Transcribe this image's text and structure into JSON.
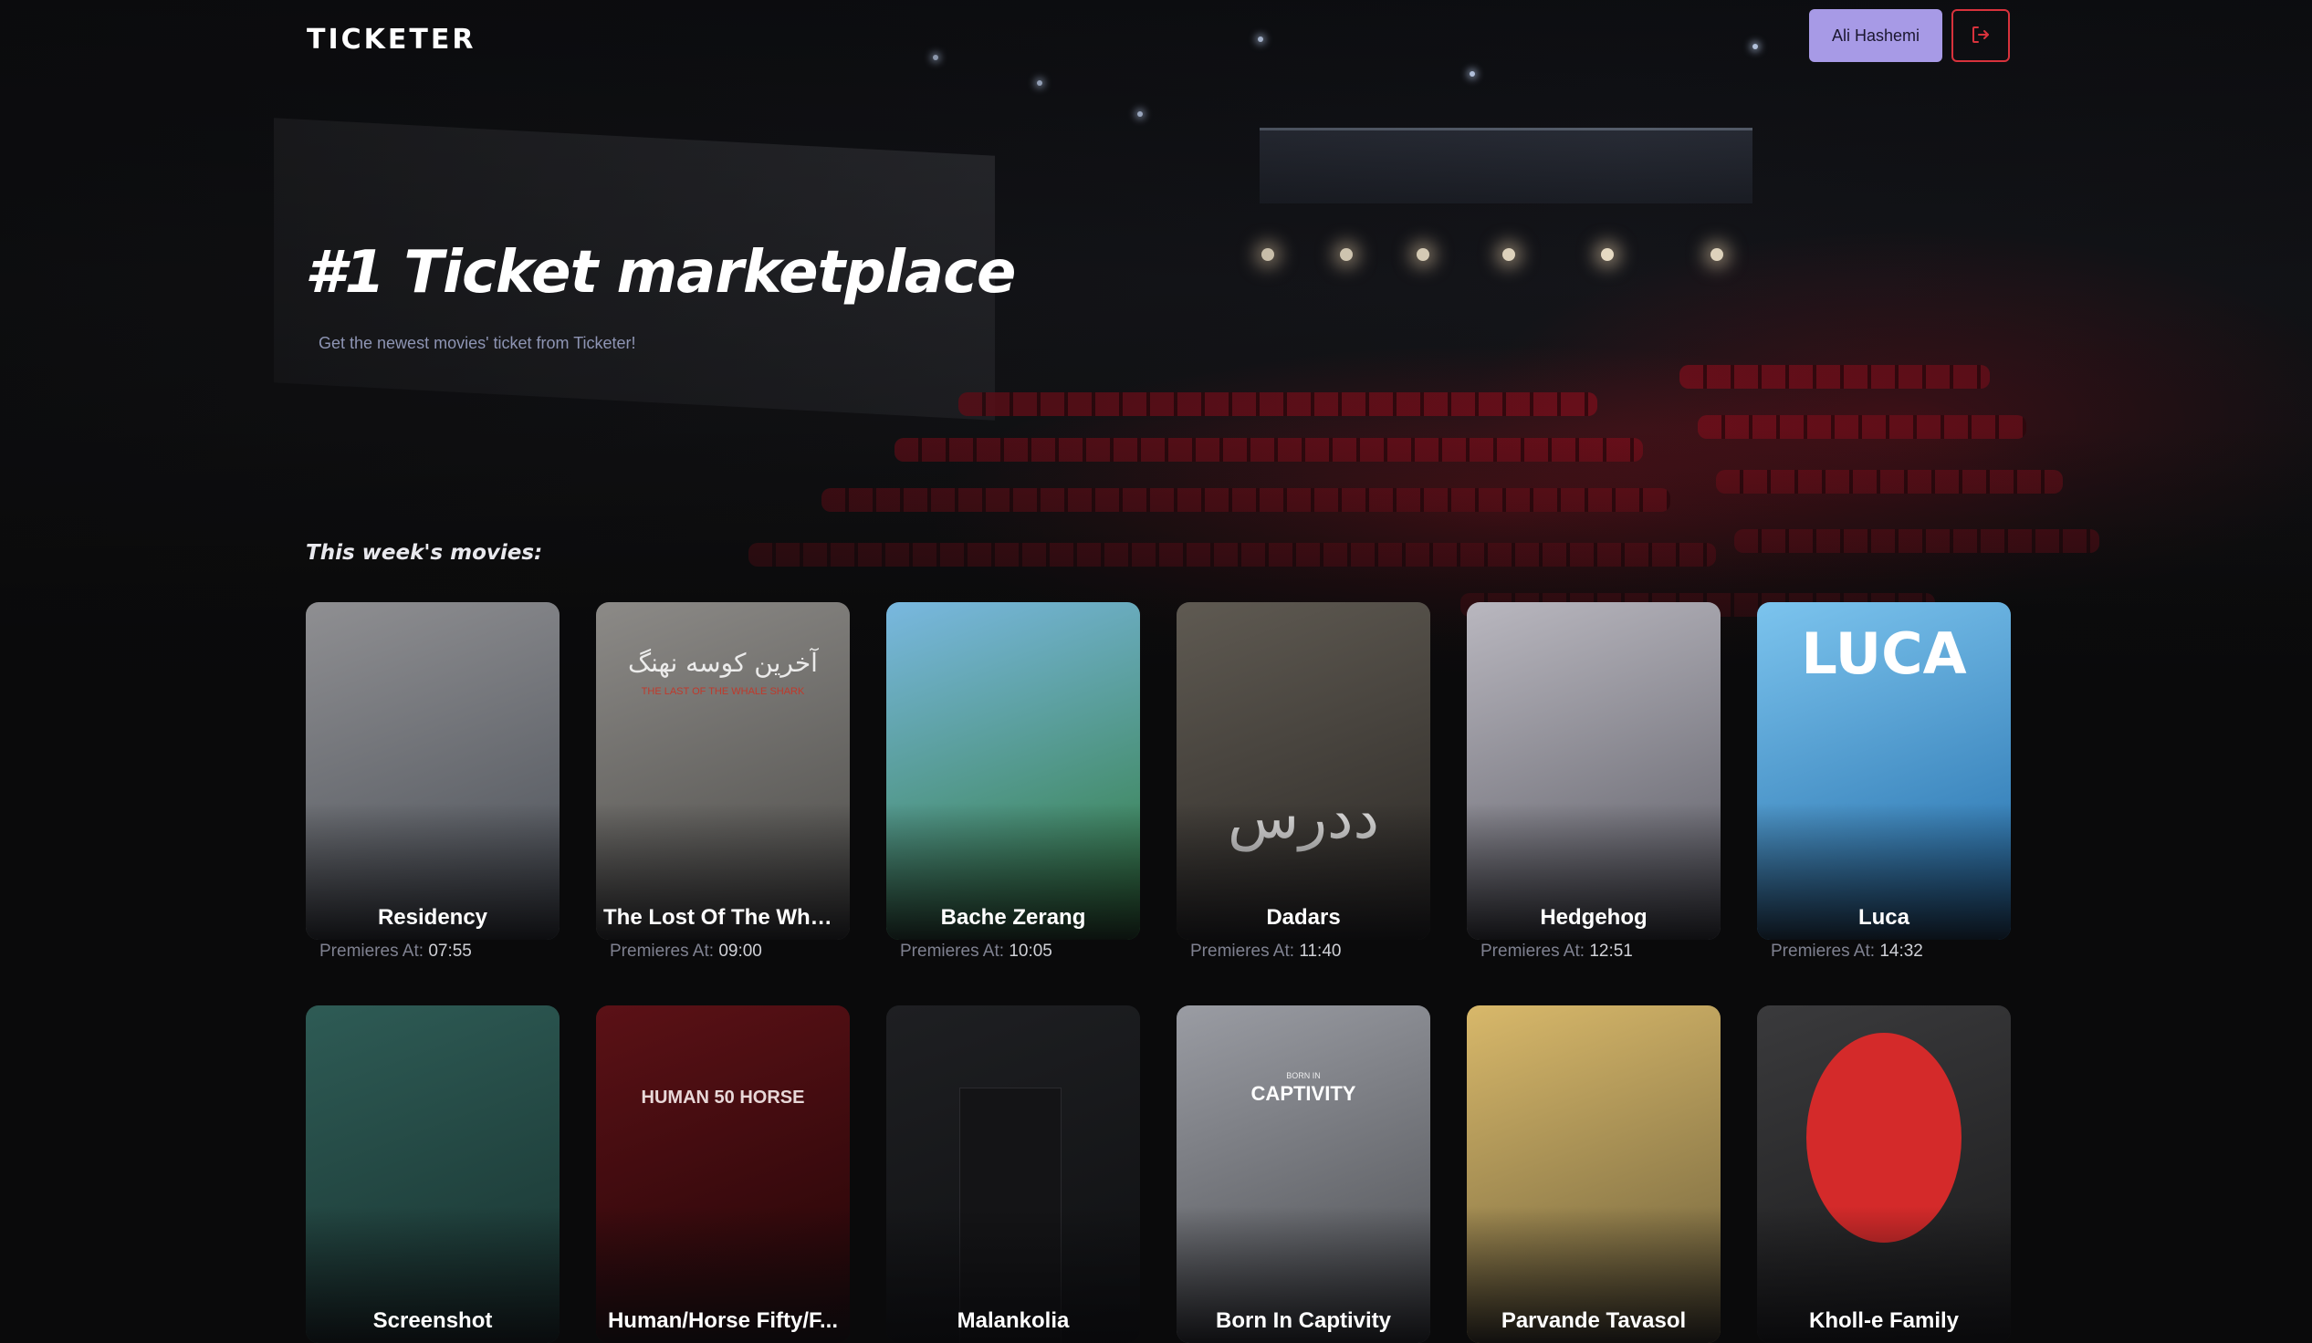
{
  "header": {
    "logo": "TICKETER",
    "user_name": "Ali Hashemi",
    "logout_icon": "logout-icon"
  },
  "hero": {
    "title": "#1 Ticket marketplace",
    "subtitle": "Get the newest movies' ticket from Ticketer!"
  },
  "section": {
    "title": "This week's movies:"
  },
  "premiere_label": "Premieres At:",
  "movies": [
    {
      "title": "Residency",
      "time": "07:55",
      "colors": [
        "#8f8f92",
        "#4a4f57"
      ]
    },
    {
      "title": "The Lost Of The Whal...",
      "time": "09:00",
      "colors": [
        "#8c8a87",
        "#4b4a47"
      ]
    },
    {
      "title": "Bache Zerang",
      "time": "10:05",
      "colors": [
        "#79b8e0",
        "#2e7a3a"
      ]
    },
    {
      "title": "Dadars",
      "time": "11:40",
      "colors": [
        "#5f5a52",
        "#2a2724"
      ]
    },
    {
      "title": "Hedgehog",
      "time": "12:51",
      "colors": [
        "#b9b7bf",
        "#5a5a63"
      ]
    },
    {
      "title": "Luca",
      "time": "14:32",
      "colors": [
        "#7cc4ee",
        "#1f6aa8"
      ]
    },
    {
      "title": "Screenshot",
      "time": "",
      "colors": [
        "#2e5b55",
        "#183330"
      ]
    },
    {
      "title": "Human/Horse Fifty/F...",
      "time": "",
      "colors": [
        "#5b1116",
        "#220507"
      ]
    },
    {
      "title": "Malankolia",
      "time": "",
      "colors": [
        "#1e1f22",
        "#0f1012"
      ]
    },
    {
      "title": "Born In Captivity",
      "time": "",
      "colors": [
        "#9a9ca3",
        "#4a4c50"
      ]
    },
    {
      "title": "Parvande Tavasol",
      "time": "",
      "colors": [
        "#d8b86a",
        "#6b5e3a"
      ]
    },
    {
      "title": "Kholl-e Family",
      "time": "",
      "colors": [
        "#3a3a3c",
        "#1a1a1b"
      ]
    }
  ],
  "poster_texts": {
    "whale_fa": "آخرین کوسه نهنگ",
    "whale_en": "THE LAST OF THE WHALE SHARK",
    "luca": "LUCA",
    "captivity_small": "BORN IN",
    "captivity": "CAPTIVITY",
    "human_horse": "HUMAN 50 HORSE",
    "dadars_fa": "ددرس"
  }
}
